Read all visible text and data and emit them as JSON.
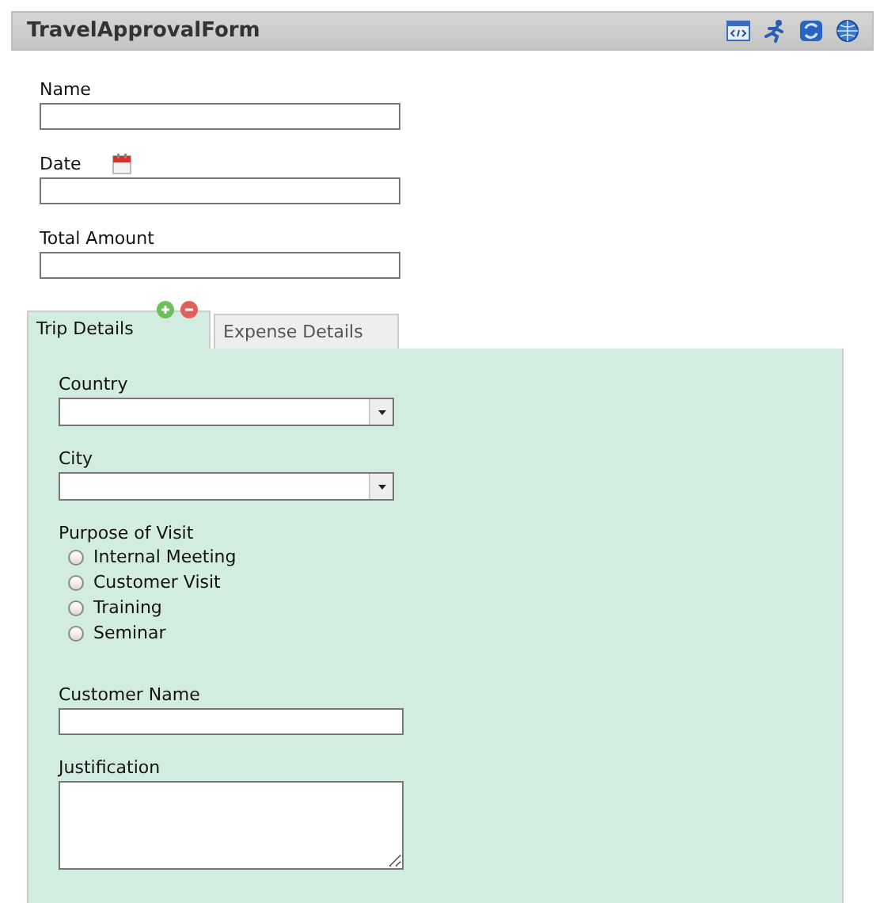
{
  "form": {
    "title": "TravelApprovalForm"
  },
  "fields": [
    {
      "label": "Name",
      "kind": "text"
    },
    {
      "label": "Date",
      "kind": "date"
    },
    {
      "label": "Total Amount",
      "kind": "text"
    }
  ],
  "tabs": [
    {
      "label": "Trip Details",
      "selected": true
    },
    {
      "label": "Expense Details",
      "selected": false
    }
  ],
  "panel_fields": [
    {
      "kind": "select",
      "label": "Country"
    },
    {
      "kind": "select",
      "label": "City"
    },
    {
      "kind": "radio",
      "label": "Purpose of Visit",
      "options": [
        {
          "label": "Internal Meeting",
          "selected": false
        },
        {
          "label": "Customer Visit",
          "selected": false
        },
        {
          "label": "Training",
          "selected": false
        },
        {
          "label": "Seminar",
          "selected": false
        }
      ]
    },
    {
      "kind": "text",
      "label": "Customer Name"
    },
    {
      "kind": "textarea",
      "label": "Justification"
    }
  ]
}
